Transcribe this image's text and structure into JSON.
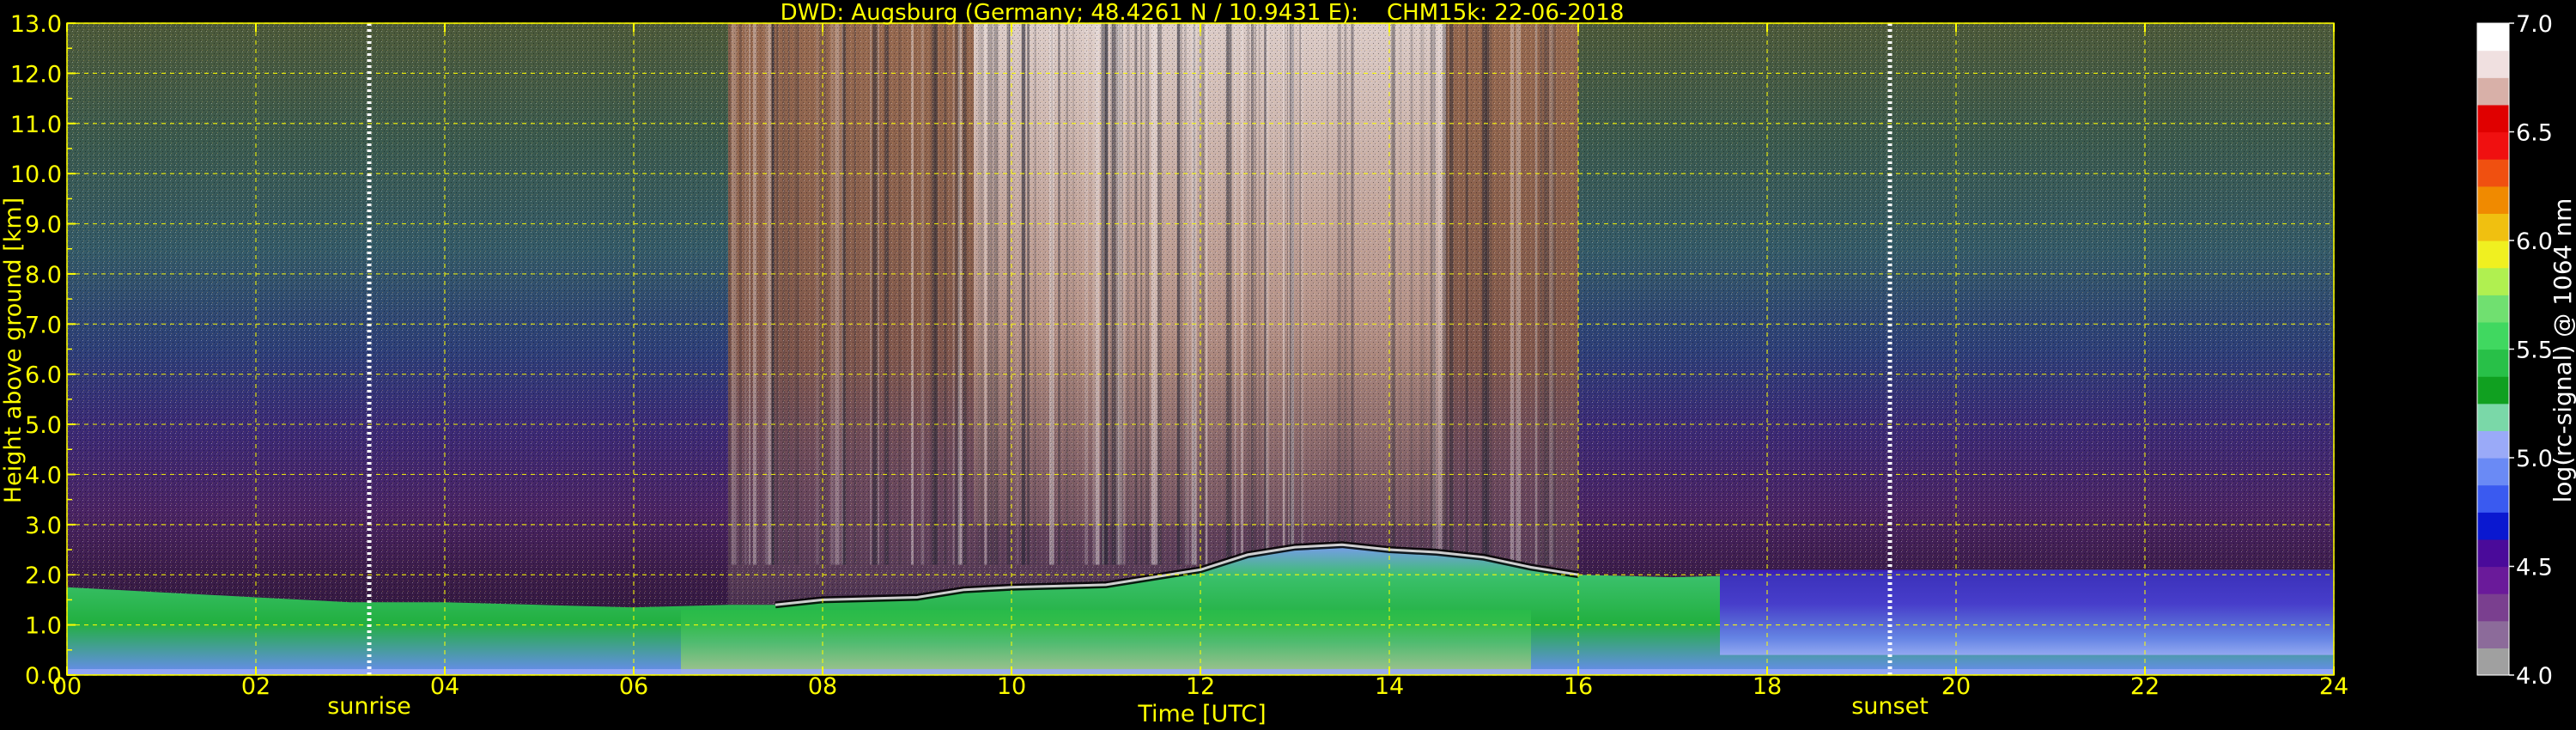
{
  "chart_data": {
    "type": "heatmap",
    "title": "DWD: Augsburg (Germany; 48.4261 N / 10.9431 E):    CHM15k: 22-06-2018",
    "xlabel": "Time [UTC]",
    "ylabel": "Height above ground [km]",
    "xlim": [
      0,
      24
    ],
    "ylim": [
      0,
      13
    ],
    "x_ticks": [
      "00",
      "02",
      "04",
      "06",
      "08",
      "10",
      "12",
      "14",
      "16",
      "18",
      "20",
      "22",
      "24"
    ],
    "x_tick_values": [
      0,
      2,
      4,
      6,
      8,
      10,
      12,
      14,
      16,
      18,
      20,
      22,
      24
    ],
    "y_ticks": [
      "0.0",
      "1.0",
      "2.0",
      "3.0",
      "4.0",
      "5.0",
      "6.0",
      "7.0",
      "8.0",
      "9.0",
      "10.0",
      "11.0",
      "12.0",
      "13.0"
    ],
    "y_minor_ticks": [
      "0.5",
      "1.5",
      "2.5",
      "3.5",
      "4.5",
      "5.5",
      "6.5",
      "7.5",
      "8.5",
      "9.5",
      "10.5",
      "11.5",
      "12.5"
    ],
    "grid": true,
    "grid_color": "#ffff00",
    "text_color": "#ffff00",
    "annotations": [
      {
        "label": "sunrise",
        "x": 3.2
      },
      {
        "label": "sunset",
        "x": 19.3
      }
    ],
    "colorbar": {
      "label": "log(rc-signal) @ 1064 nm",
      "range": [
        4.0,
        7.0
      ],
      "ticks": [
        "4.0",
        "4.5",
        "5.0",
        "5.5",
        "6.0",
        "6.5",
        "7.0"
      ],
      "colors": [
        "#a0a0a0",
        "#8c6b9a",
        "#7a3f8f",
        "#6a1a9a",
        "#4a0a9a",
        "#0a18d0",
        "#3a5af0",
        "#6a8af5",
        "#9aaaf8",
        "#7ad8a8",
        "#10a020",
        "#28c048",
        "#40d860",
        "#70e070",
        "#b0f050",
        "#f0f020",
        "#f0c010",
        "#f08a00",
        "#f05010",
        "#f01010",
        "#e00000",
        "#d8b0a8",
        "#f0e0e0",
        "#ffffff"
      ]
    },
    "boundary_layer_top_km": [
      [
        0,
        1.75
      ],
      [
        1,
        1.65
      ],
      [
        2,
        1.55
      ],
      [
        3,
        1.45
      ],
      [
        4,
        1.45
      ],
      [
        5,
        1.4
      ],
      [
        6,
        1.35
      ],
      [
        7,
        1.4
      ],
      [
        7.5,
        1.4
      ],
      [
        8,
        1.5
      ],
      [
        9,
        1.55
      ],
      [
        9.5,
        1.7
      ],
      [
        10,
        1.75
      ],
      [
        11,
        1.8
      ],
      [
        12,
        2.1
      ],
      [
        12.5,
        2.4
      ],
      [
        13,
        2.55
      ],
      [
        13.5,
        2.6
      ],
      [
        14,
        2.5
      ],
      [
        14.5,
        2.45
      ],
      [
        15,
        2.35
      ],
      [
        15.5,
        2.15
      ],
      [
        16,
        2.0
      ],
      [
        17,
        1.95
      ],
      [
        18,
        2.0
      ],
      [
        19,
        2.05
      ],
      [
        20,
        2.1
      ],
      [
        21,
        2.1
      ],
      [
        22,
        2.1
      ],
      [
        23,
        2.1
      ],
      [
        24,
        2.1
      ]
    ]
  }
}
